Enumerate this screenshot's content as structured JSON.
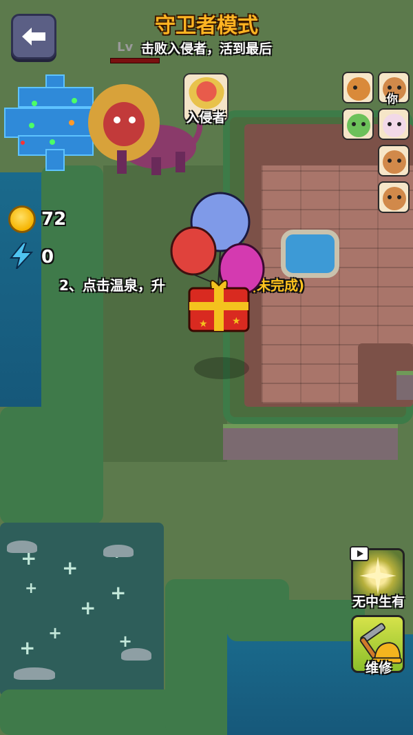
{
  "header": {
    "title": "守卫者模式",
    "subtitle": "击败入侵者，活到最后",
    "level_prefix": "Lv"
  },
  "back_button": {
    "icon": "back-arrow-icon"
  },
  "invader": {
    "label": "入侵者",
    "icon": "lion-monster-icon"
  },
  "players": [
    {
      "name": "capybara-dino",
      "icon": "capybara-dino-avatar",
      "color": "#d98a3a"
    },
    {
      "name": "capybara-you",
      "icon": "capybara-pilot-avatar",
      "color": "#d1894a",
      "tag": "你"
    },
    {
      "name": "capybara-frog",
      "icon": "capybara-frog-avatar",
      "color": "#6cc15a"
    },
    {
      "name": "capybara-unicorn",
      "icon": "capybara-unicorn-avatar",
      "color": "#f2d9e8"
    },
    {
      "name": "capybara-pilot-2",
      "icon": "capybara-pilot-avatar",
      "color": "#d1894a"
    },
    {
      "name": "capybara-pilot-3",
      "icon": "capybara-pilot-avatar",
      "color": "#d1894a"
    }
  ],
  "resources": {
    "coins": "72",
    "energy": "0"
  },
  "task": {
    "text": "2、点击温泉，升级温泉",
    "visible_start": "2、点击温泉，升",
    "visible_end": "温泉",
    "status": "(未完成)"
  },
  "skills": [
    {
      "label": "无中生有",
      "icon": "sparkle-burst-icon",
      "has_video": true
    },
    {
      "label": "维修",
      "icon": "hammer-helmet-icon",
      "has_video": false
    }
  ],
  "colors": {
    "title": "#ffb422",
    "task_status": "#ffc21e",
    "minimap": "#2f8ad9"
  }
}
